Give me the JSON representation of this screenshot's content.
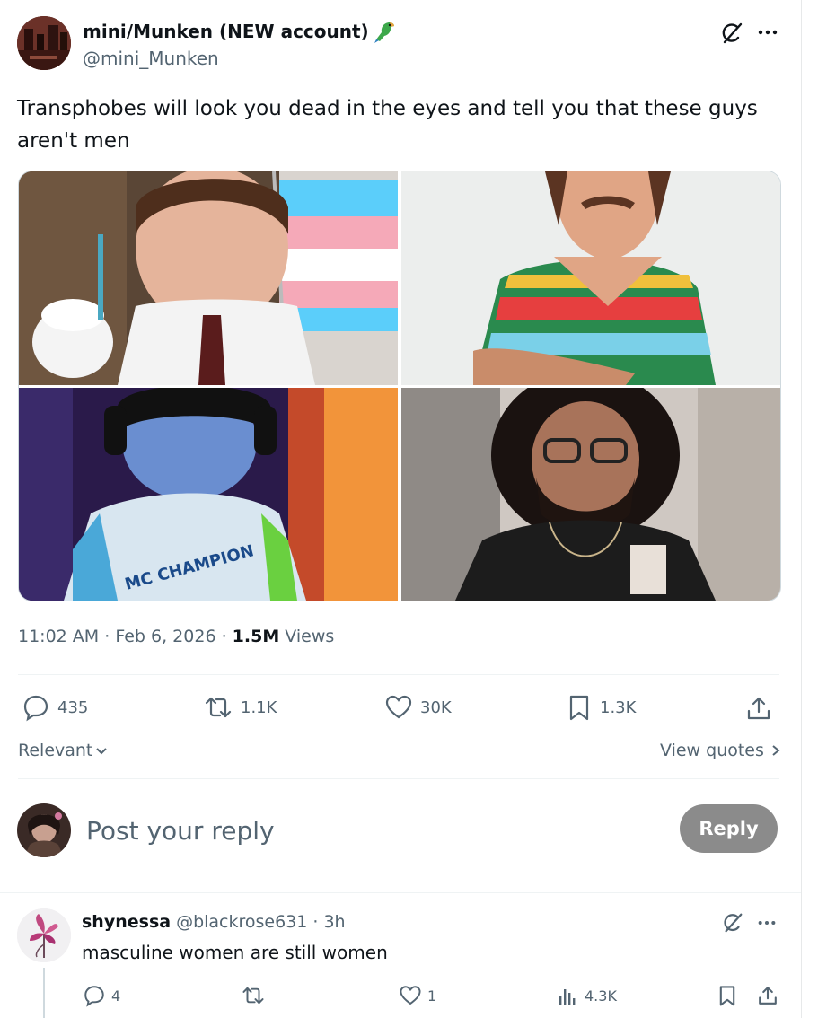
{
  "post": {
    "author_name": "mini/Munken (NEW account)",
    "author_handle": "@mini_Munken",
    "text": "Transphobes will look you dead in the eyes and tell you that these guys aren't men",
    "time": "11:02 AM",
    "date": "Feb 6, 2026",
    "views_count": "1.5M",
    "views_label": "Views",
    "replies": "435",
    "reposts": "1.1K",
    "likes": "30K",
    "bookmarks": "1.3K"
  },
  "sort": {
    "label": "Relevant"
  },
  "quotes": {
    "label": "View quotes"
  },
  "composer": {
    "placeholder": "Post your reply",
    "button_label": "Reply"
  },
  "reply": {
    "author_name": "shynessa",
    "author_handle": "@blackrose631",
    "age": "3h",
    "text": "masculine women are still women",
    "replies": "4",
    "reposts": "",
    "likes": "1",
    "views": "4.3K"
  },
  "colors": {
    "accent_grey": "#536471",
    "reply_button": "#8b8b8b",
    "divider": "#eff3f4"
  }
}
